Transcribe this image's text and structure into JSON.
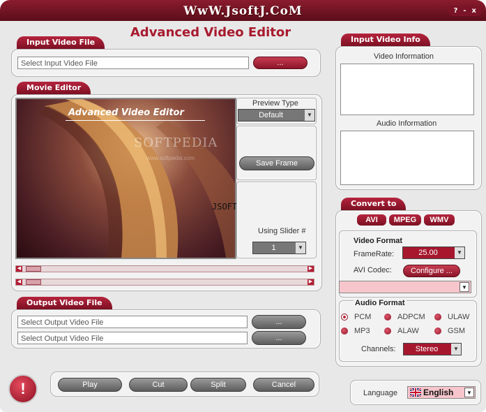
{
  "window": {
    "site_title": "WwW.JsoftJ.CoM",
    "help_btn": "?",
    "minimize_btn": "-",
    "close_btn": "x"
  },
  "app_title": "Advanced Video Editor",
  "input_video": {
    "tab": "Input Video File",
    "placeholder": "Select Input Video File",
    "browse": "..."
  },
  "movie_editor": {
    "tab": "Movie Editor",
    "preview_title": "Advanced Video Editor",
    "watermark": "SOFTPEDIA",
    "watermark_url": "www.softpedia.com",
    "overlay": "JSOFTJ.COM",
    "preview_type_label": "Preview Type",
    "preview_type_value": "Default",
    "save_frame": "Save Frame",
    "using_slider_label": "Using Slider #",
    "slider_value": "1"
  },
  "output_video": {
    "tab": "Output Video File",
    "placeholder1": "Select Output Video File",
    "placeholder2": "Select Output Video File",
    "browse1": "...",
    "browse2": "..."
  },
  "bottom": {
    "play": "Play",
    "cut": "Cut",
    "split": "Split",
    "cancel": "Cancel",
    "alert_icon": "!"
  },
  "input_info": {
    "tab": "Input Video Info",
    "video_info": "Video Information",
    "audio_info": "Audio Information"
  },
  "convert": {
    "tab": "Convert to",
    "formats": [
      "AVI",
      "MPEG",
      "WMV"
    ],
    "video_format": "Video Format",
    "framerate_label": "FrameRate:",
    "framerate_value": "25.00",
    "avi_codec_label": "AVI Codec:",
    "configure": "Configure ...",
    "audio_format": "Audio Format",
    "audio_options": [
      "PCM",
      "ADPCM",
      "ULAW",
      "MP3",
      "ALAW",
      "GSM"
    ],
    "channels_label": "Channels:",
    "channels_value": "Stereo"
  },
  "language": {
    "label": "Language",
    "value": "English"
  },
  "colors": {
    "accent": "#a81b2f",
    "tab": "#8c1528",
    "panel": "#f2f2f2"
  }
}
